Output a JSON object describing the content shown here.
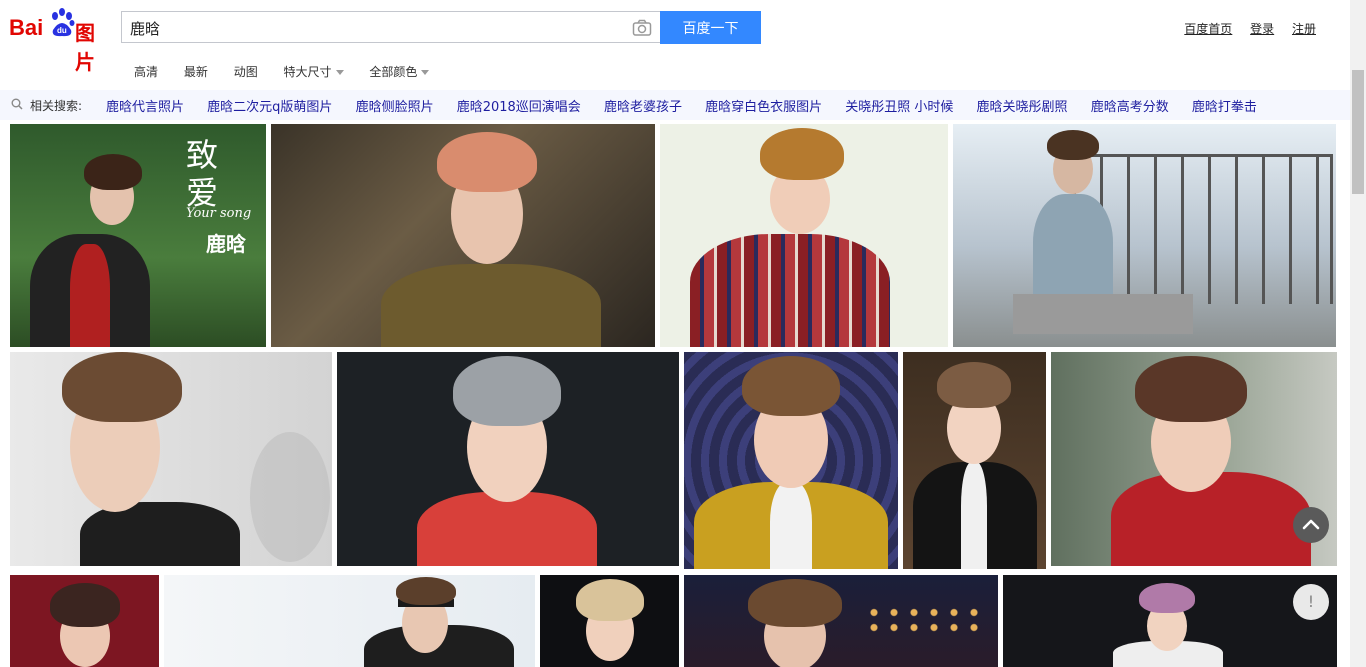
{
  "header": {
    "logo_text": "Baidu图片",
    "search_value": "鹿晗",
    "search_button": "百度一下",
    "top_links": [
      "百度首页",
      "登录",
      "注册"
    ]
  },
  "filters": [
    "高清",
    "最新",
    "动图",
    "特大尺寸",
    "全部颜色"
  ],
  "related": {
    "label": "相关搜索:",
    "items": [
      "鹿晗代言照片",
      "鹿晗二次元q版萌图片",
      "鹿晗侧脸照片",
      "鹿晗2018巡回演唱会",
      "鹿晗老婆孩子",
      "鹿晗穿白色衣服图片",
      "关晓彤丑照 小时候",
      "鹿晗关晓彤剧照",
      "鹿晗高考分数",
      "鹿晗打拳击"
    ]
  },
  "tile_text": {
    "t1_title": "致爱",
    "t1_sub": "Your song",
    "t1_name": "鹿晗"
  },
  "float_buttons": {
    "feedback_label": "!"
  }
}
